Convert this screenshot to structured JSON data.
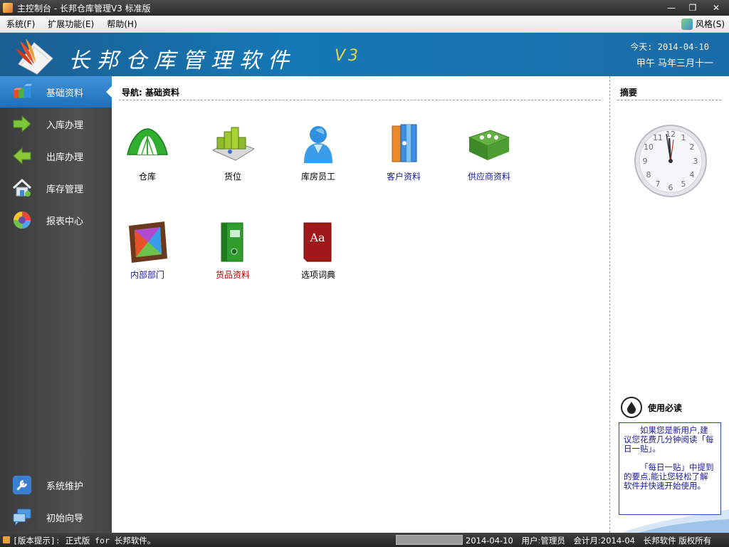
{
  "window": {
    "title": "主控制台 - 长邦仓库管理V3 标准版"
  },
  "menu": {
    "items": [
      "系统(F)",
      "扩展功能(E)",
      "帮助(H)"
    ],
    "style_label": "风格(S)"
  },
  "header": {
    "brand": "长邦仓库管理软件",
    "version": "V3",
    "date_line": "今天: 2014-04-10",
    "lunar_line": "甲午 马年三月十一"
  },
  "sidebar": {
    "items": [
      {
        "label": "基础资料",
        "icon": "cubes-icon",
        "active": true
      },
      {
        "label": "入库办理",
        "icon": "arrow-right-icon"
      },
      {
        "label": "出库办理",
        "icon": "arrow-left-icon"
      },
      {
        "label": "库存管理",
        "icon": "house-icon"
      },
      {
        "label": "报表中心",
        "icon": "pie-icon"
      }
    ],
    "bottom_items": [
      {
        "label": "系统维护",
        "icon": "wrench-icon"
      },
      {
        "label": "初始向导",
        "icon": "chat-icon"
      }
    ]
  },
  "main": {
    "nav_title": "导航: 基础资料",
    "tiles": [
      {
        "label": "仓库",
        "icon": "tent-icon",
        "color": "#000000"
      },
      {
        "label": "货位",
        "icon": "shelf-icon",
        "color": "#000000"
      },
      {
        "label": "库房员工",
        "icon": "person-icon",
        "color": "#000000"
      },
      {
        "label": "客户资料",
        "icon": "customer-icon",
        "color": "#1a1aa0"
      },
      {
        "label": "供应商资料",
        "icon": "supplier-icon",
        "color": "#1a1aa0"
      },
      {
        "label": "内部部门",
        "icon": "departments-icon",
        "color": "#1a1aa0"
      },
      {
        "label": "货品资料",
        "icon": "binder-icon",
        "color": "#c00000"
      },
      {
        "label": "选项词典",
        "icon": "dictionary-icon",
        "color": "#000000"
      }
    ]
  },
  "summary": {
    "title": "摘要",
    "read_title": "使用必读",
    "read_p1": "如果您是新用户,建议您花费几分钟阅读「每日一贴」。",
    "read_p2": "「每日一贴」中提到的要点,能让您轻松了解软件并快速开始使用。"
  },
  "status": {
    "hint": "[版本提示]: 正式版 for 长邦软件。",
    "date": "2014-04-10",
    "user": "用户:管理员",
    "period": "会计月:2014-04",
    "copyright": "长邦软件 版权所有"
  }
}
